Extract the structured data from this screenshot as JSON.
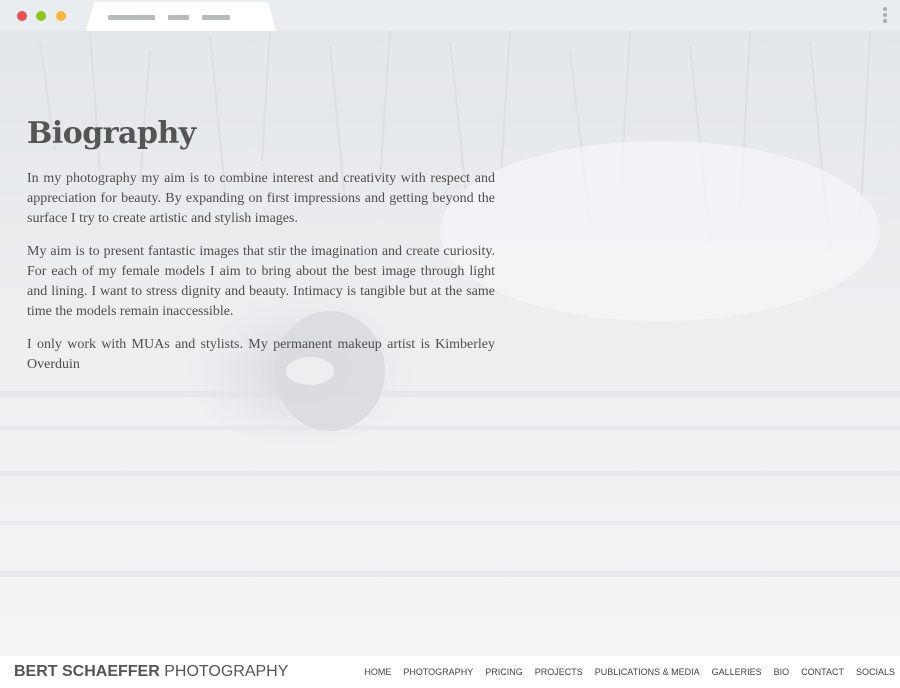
{
  "colors": {
    "chrome_bg": "#e9edf0",
    "tab_bg": "#ffffff",
    "tab_lines": "#b8bcc1",
    "dot_red": "#e84f4f",
    "dot_green": "#8dc21f",
    "dot_yellow": "#f5b83d",
    "kebab": "#a9adb2",
    "hero_tint": "#eef0f2",
    "text_dark": "#4e4e4e",
    "heading": "#555555",
    "footer_text": "#555555",
    "nav_text": "#444444"
  },
  "chrome": {
    "window_controls": [
      "close-dot",
      "minimize-dot",
      "maximize-dot"
    ],
    "menu_icon": "kebab-menu-icon"
  },
  "page": {
    "title": "Biography",
    "paragraphs": [
      "In my photography my aim is to combine interest and creativity with respect and appreciation for beauty. By expanding on first impressions and getting beyond the surface I try to create artistic and stylish images.",
      "My aim is to present fantastic images that stir the imagination and create curiosity. For each of my female models I aim to bring about the best image through light and lining. I want to stress dignity and beauty. Intimacy is tangible but at the same time the models remain inaccessible.",
      "I only work with MUAs and stylists. My permanent makeup artist is Kimberley Overduin"
    ]
  },
  "footer": {
    "brand_bold": "BERT SCHAEFFER",
    "brand_light": "PHOTOGRAPHY",
    "nav": [
      "HOME",
      "PHOTOGRAPHY",
      "PRICING",
      "PROJECTS",
      "PUBLICATIONS & MEDIA",
      "GALLERIES",
      "BIO",
      "CONTACT",
      "SOCIALS"
    ]
  }
}
